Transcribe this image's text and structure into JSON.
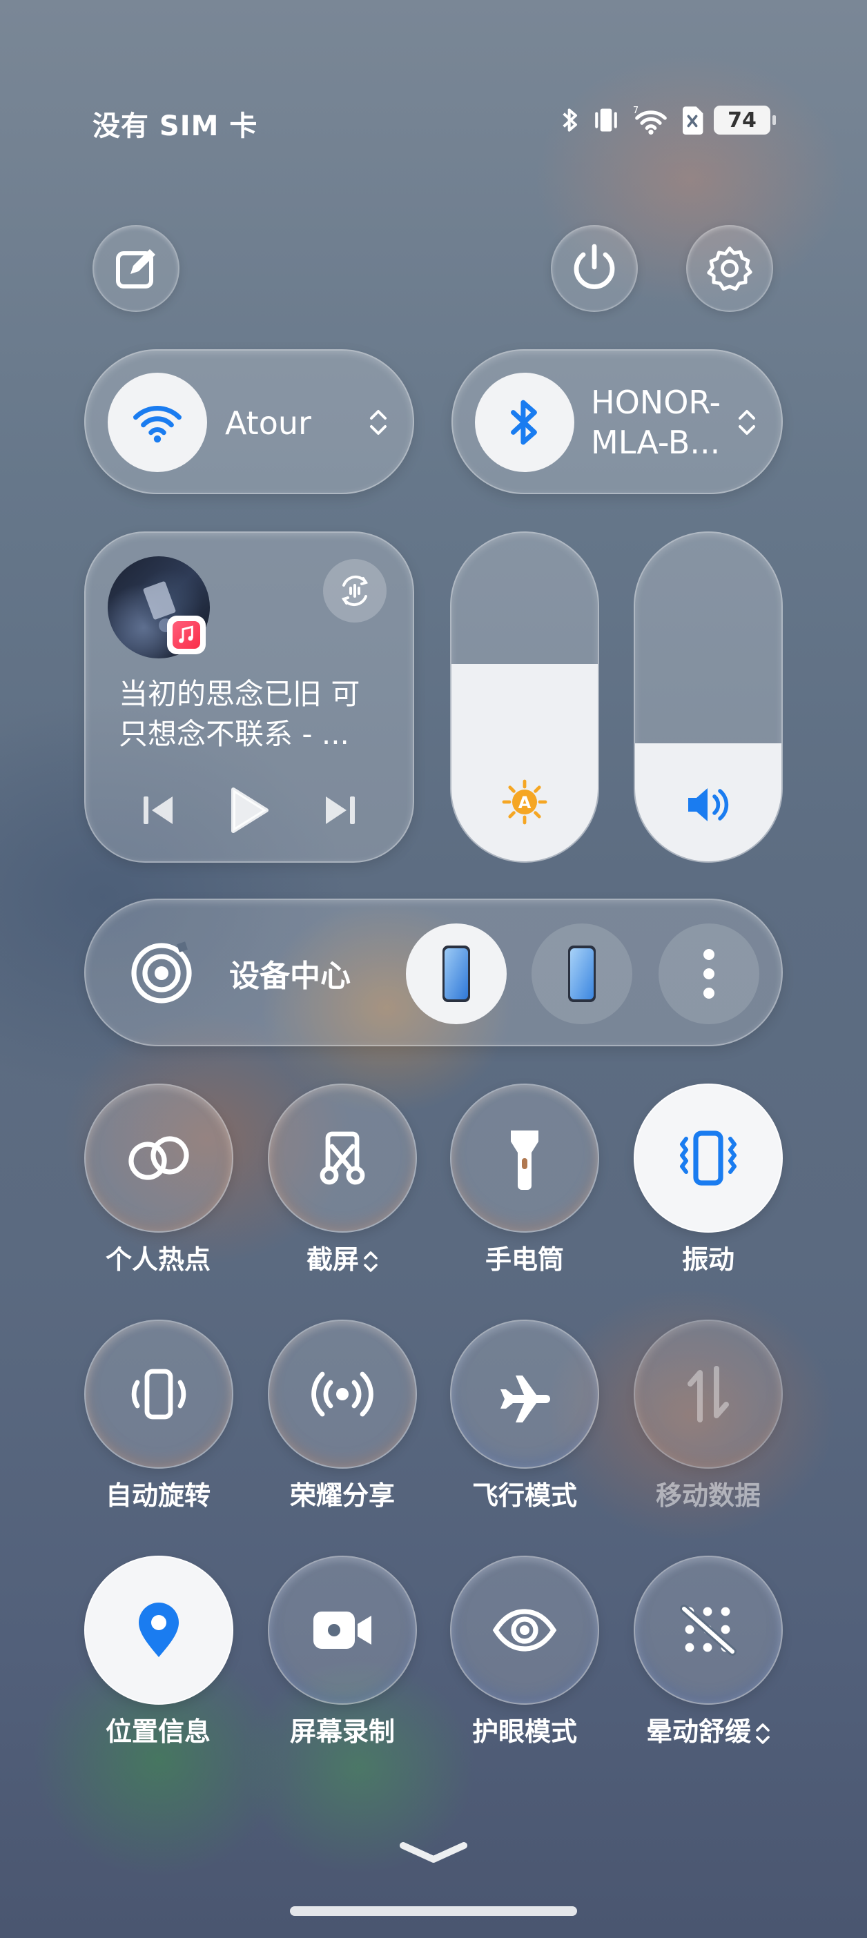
{
  "status_bar": {
    "carrier": "没有 SIM 卡",
    "battery": "74",
    "icons": [
      "bluetooth-icon",
      "vibrate-icon",
      "wifi-icon",
      "no-sim-icon",
      "battery-icon"
    ]
  },
  "top_actions": {
    "edit_icon": "edit-icon",
    "power_icon": "power-icon",
    "settings_icon": "gear-icon"
  },
  "wifi": {
    "label": "Atour",
    "icon": "wifi-icon",
    "enabled": true
  },
  "bluetooth": {
    "label_line1": "HONOR-",
    "label_line2": "MLA-B...",
    "icon": "bluetooth-icon",
    "enabled": true
  },
  "media": {
    "title_line1": "当初的思念已旧 可",
    "title_line2": "只想念不联系 - ...",
    "app_icon": "music-icon"
  },
  "brightness": {
    "level": 0.6,
    "icon": "auto-brightness-icon"
  },
  "volume": {
    "level": 0.36,
    "icon": "volume-icon"
  },
  "device_center": {
    "label": "设备中心"
  },
  "toggles": [
    {
      "label": "个人热点",
      "icon": "hotspot-icon",
      "on": false
    },
    {
      "label": "截屏",
      "icon": "screenshot-icon",
      "on": false,
      "has_chevron": true
    },
    {
      "label": "手电筒",
      "icon": "flashlight-icon",
      "on": false
    },
    {
      "label": "振动",
      "icon": "vibrate-icon",
      "on": true
    },
    {
      "label": "自动旋转",
      "icon": "auto-rotate-icon",
      "on": false
    },
    {
      "label": "荣耀分享",
      "icon": "share-icon",
      "on": false
    },
    {
      "label": "飞行模式",
      "icon": "airplane-icon",
      "on": false
    },
    {
      "label": "移动数据",
      "icon": "mobile-data-icon",
      "on": false,
      "disabled": true
    },
    {
      "label": "位置信息",
      "icon": "location-icon",
      "on": true
    },
    {
      "label": "屏幕录制",
      "icon": "screen-record-icon",
      "on": false
    },
    {
      "label": "护眼模式",
      "icon": "eye-comfort-icon",
      "on": false
    },
    {
      "label": "晕动舒缓",
      "icon": "motion-comfort-icon",
      "on": false,
      "has_chevron": true
    }
  ],
  "colors": {
    "accent": "#1a7cf0",
    "tile_on": "#f5f6f8",
    "brightness_icon": "#f5a623"
  }
}
